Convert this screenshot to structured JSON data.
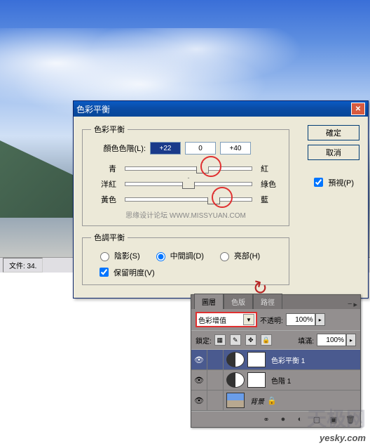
{
  "statusbar": {
    "file": "文件: 34."
  },
  "dialog": {
    "title": "色彩平衡",
    "group_balance": "色彩平衡",
    "levels_label": "顏色色階(L):",
    "v1": "+22",
    "v2": "0",
    "v3": "+40",
    "cyan": "青",
    "red": "紅",
    "magenta": "洋紅",
    "green": "綠色",
    "yellow": "黃色",
    "blue": "藍",
    "watermark": "思缘设计论坛  WWW.MISSYUAN.COM",
    "group_tone": "色調平衡",
    "r_shadow": "陰影(S)",
    "r_mid": "中間調(D)",
    "r_high": "亮部(H)",
    "preserve": "保留明度(V)",
    "ok": "確定",
    "cancel": "取消",
    "preview": "預視(P)"
  },
  "panel": {
    "tabs": {
      "layers": "圖層",
      "channels": "色版",
      "paths": "路徑"
    },
    "blend": "色彩增值",
    "opacity_lbl": "不透明:",
    "opacity_val": "100%",
    "lock_lbl": "鎖定:",
    "fill_lbl": "填滿:",
    "fill_val": "100%",
    "layer1": "色彩平衡 1",
    "layer2": "色階 1",
    "layer3": "背景"
  },
  "yesky": "yesky.com"
}
